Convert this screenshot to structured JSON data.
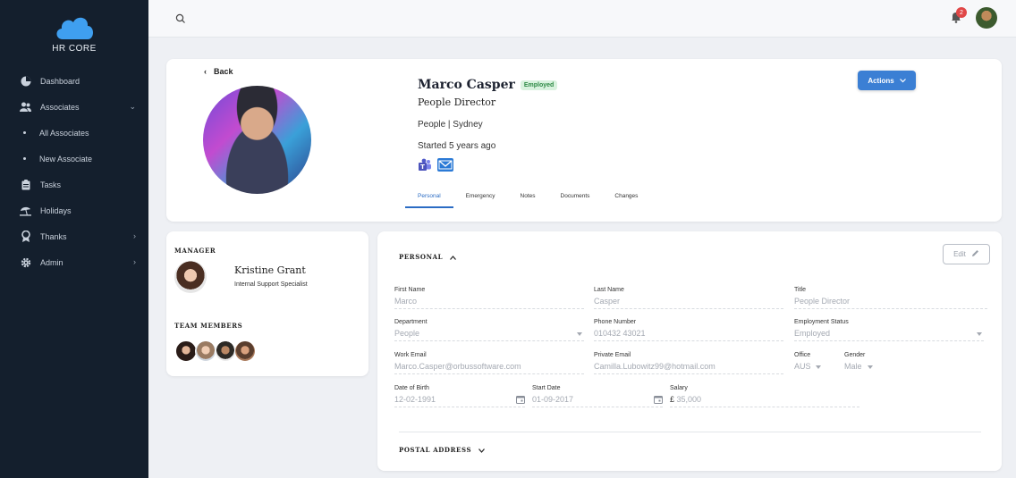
{
  "brand": {
    "name": "HR CORE"
  },
  "sidebar": {
    "items": [
      {
        "label": "Dashboard"
      },
      {
        "label": "Associates"
      },
      {
        "label": "All Associates"
      },
      {
        "label": "New Associate"
      },
      {
        "label": "Tasks"
      },
      {
        "label": "Holidays"
      },
      {
        "label": "Thanks"
      },
      {
        "label": "Admin"
      }
    ]
  },
  "topbar": {
    "notification_count": "2"
  },
  "profile": {
    "back_label": "Back",
    "name": "Marco Casper",
    "status": "Employed",
    "role": "People Director",
    "location": "People | Sydney",
    "started": "Started 5 years ago",
    "actions_label": "Actions",
    "tabs": [
      {
        "label": "Personal"
      },
      {
        "label": "Emergency"
      },
      {
        "label": "Notes"
      },
      {
        "label": "Documents"
      },
      {
        "label": "Changes"
      }
    ]
  },
  "manager": {
    "section_label": "MANAGER",
    "name": "Kristine Grant",
    "title": "Internal Support Specialist",
    "team_label": "TEAM MEMBERS"
  },
  "personal": {
    "section_label": "PERSONAL",
    "edit_label": "Edit",
    "fields": {
      "first_name": {
        "label": "First Name",
        "value": "Marco"
      },
      "last_name": {
        "label": "Last Name",
        "value": "Casper"
      },
      "title": {
        "label": "Title",
        "value": "People Director"
      },
      "department": {
        "label": "Department",
        "value": "People"
      },
      "phone": {
        "label": "Phone Number",
        "value": "010432 43021"
      },
      "employment_status": {
        "label": "Employment Status",
        "value": "Employed"
      },
      "work_email": {
        "label": "Work Email",
        "value": "Marco.Casper@orbussoftware.com"
      },
      "private_email": {
        "label": "Private Email",
        "value": "Camilla.Lubowitz99@hotmail.com"
      },
      "office": {
        "label": "Office",
        "value": "AUS"
      },
      "gender": {
        "label": "Gender",
        "value": "Male"
      },
      "dob": {
        "label": "Date of Birth",
        "value": "12-02-1991"
      },
      "start_date": {
        "label": "Start Date",
        "value": "01-09-2017"
      },
      "salary": {
        "label": "Salary",
        "currency": "£",
        "value": "35,000"
      }
    },
    "postal_label": "POSTAL ADDRESS"
  },
  "colors": {
    "accent": "#3b7fd4",
    "sidebar_bg": "#141f2d",
    "badge_red": "#e04747",
    "employed_bg": "#d9f2de"
  }
}
